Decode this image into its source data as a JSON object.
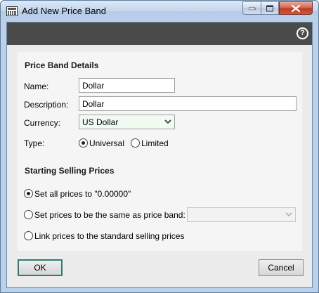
{
  "window": {
    "title": "Add New Price Band"
  },
  "section_details": {
    "title": "Price Band Details"
  },
  "fields": {
    "name_label": "Name:",
    "name_value": "Dollar",
    "description_label": "Description:",
    "description_value": "Dollar",
    "currency_label": "Currency:",
    "currency_value": "US Dollar",
    "type_label": "Type:",
    "type_options": [
      "Universal",
      "Limited"
    ],
    "type_selected": "Universal"
  },
  "section_prices": {
    "title": "Starting Selling Prices"
  },
  "price_options": [
    {
      "label": "Set all prices to \"0.00000\"",
      "selected": true
    },
    {
      "label": "Set prices to be the same as price band:",
      "selected": false
    },
    {
      "label": "Link prices to the standard selling prices",
      "selected": false
    }
  ],
  "price_band_select": {
    "value": ""
  },
  "buttons": {
    "ok": "OK",
    "cancel": "Cancel"
  },
  "icons": {
    "help": "?",
    "app": "calculator-icon"
  }
}
